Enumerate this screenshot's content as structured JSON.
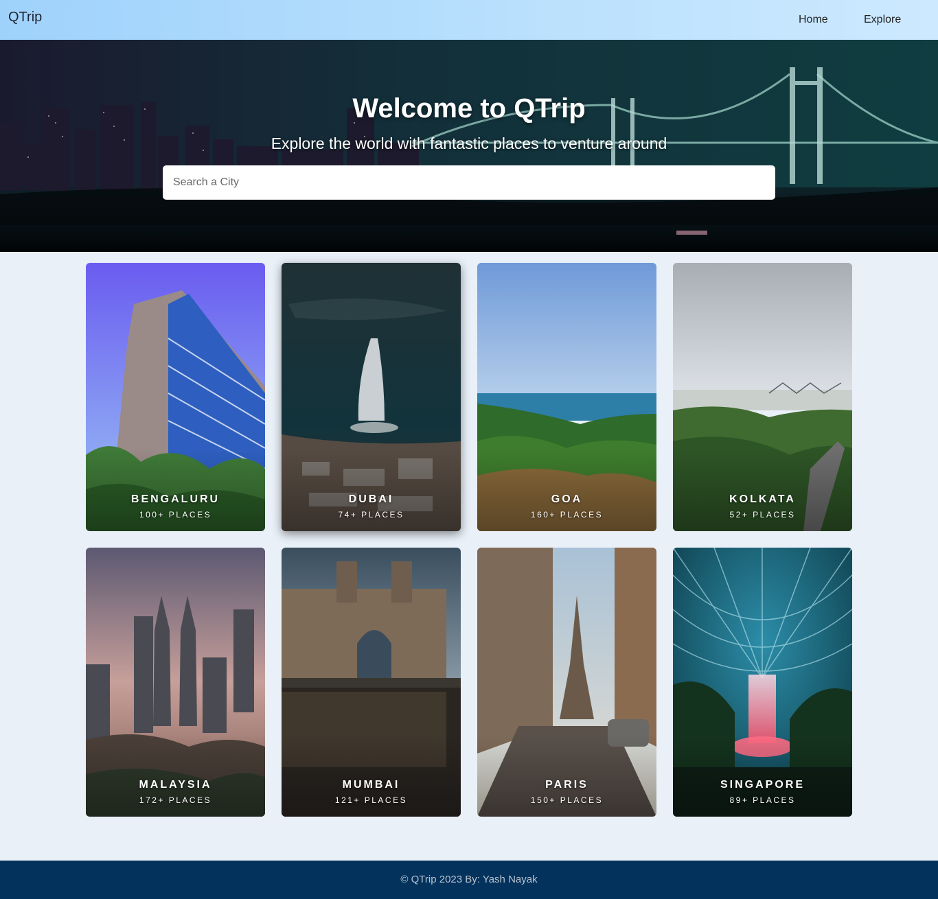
{
  "navbar": {
    "brand": "QTrip",
    "links": [
      {
        "label": "Home"
      },
      {
        "label": "Explore"
      }
    ]
  },
  "hero": {
    "title": "Welcome to QTrip",
    "subtitle": "Explore the world with fantastic places to venture around",
    "search": {
      "placeholder": "Search a City",
      "value": ""
    }
  },
  "cities": [
    {
      "name": "BENGALURU",
      "places": "100+ PLACES"
    },
    {
      "name": "DUBAI",
      "places": "74+ PLACES"
    },
    {
      "name": "GOA",
      "places": "160+ PLACES"
    },
    {
      "name": "KOLKATA",
      "places": "52+ PLACES"
    },
    {
      "name": "MALAYSIA",
      "places": "172+ PLACES"
    },
    {
      "name": "MUMBAI",
      "places": "121+ PLACES"
    },
    {
      "name": "PARIS",
      "places": "150+ PLACES"
    },
    {
      "name": "SINGAPORE",
      "places": "89+ PLACES"
    }
  ],
  "footer": {
    "text": "© QTrip 2023 By: Yash Nayak"
  },
  "colors": {
    "navbar": "#b9e0fd",
    "page_background": "#e9f0f8",
    "footer": "#03325c"
  }
}
